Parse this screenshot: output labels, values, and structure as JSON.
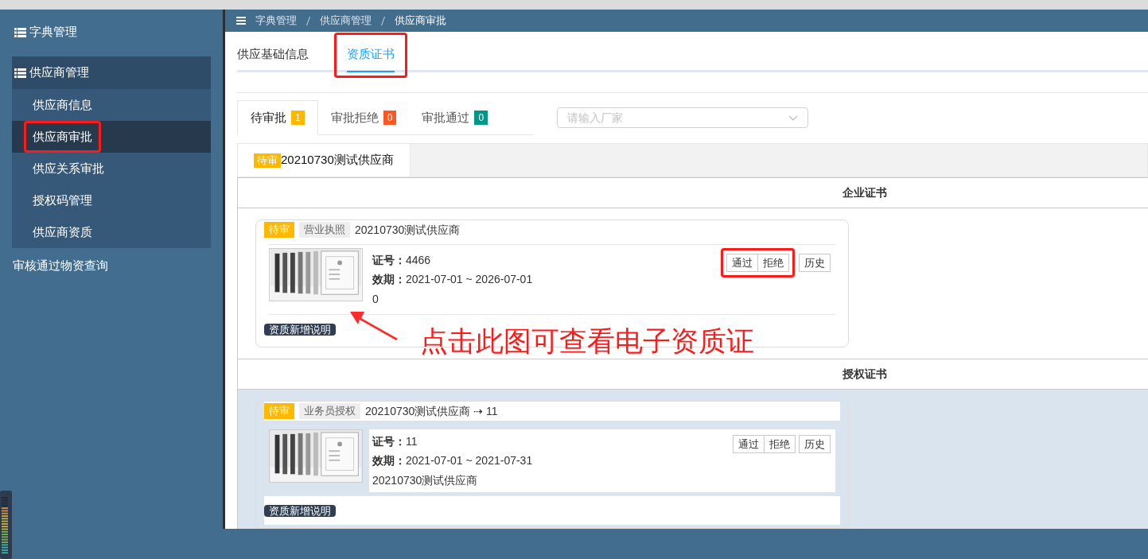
{
  "sidebar": {
    "items": [
      {
        "kind": "group",
        "label": "字典管理",
        "expanded": false
      },
      {
        "kind": "group",
        "label": "供应商管理",
        "expanded": true,
        "children": [
          {
            "label": "供应商信息",
            "selected": false,
            "highlighted": false
          },
          {
            "label": "供应商审批",
            "selected": true,
            "highlighted": true
          },
          {
            "label": "供应关系审批",
            "selected": false,
            "highlighted": false
          },
          {
            "label": "授权码管理",
            "selected": false,
            "highlighted": false
          },
          {
            "label": "供应商资质",
            "selected": false,
            "highlighted": false
          }
        ]
      },
      {
        "kind": "link",
        "label": "审核通过物资查询"
      }
    ]
  },
  "breadcrumb": [
    "字典管理",
    "供应商管理",
    "供应商审批"
  ],
  "tabs": [
    {
      "label": "供应基础信息",
      "selected": false,
      "highlighted": false
    },
    {
      "label": "资质证书",
      "selected": true,
      "highlighted": true
    }
  ],
  "status_tabs": [
    {
      "label": "待审批",
      "count": "1",
      "color": "#ffb800",
      "selected": true
    },
    {
      "label": "审批拒绝",
      "count": "0",
      "color": "#ff5722",
      "selected": false
    },
    {
      "label": "审批通过",
      "count": "0",
      "color": "#009688",
      "selected": false
    }
  ],
  "vendor_filter": {
    "placeholder": "请输入厂家"
  },
  "vendor_tabs": [
    {
      "badge": "待审",
      "label": "20210730测试供应商",
      "selected": true
    }
  ],
  "sections": [
    {
      "title": "企业证书",
      "shaded": false,
      "cards": [
        {
          "status": "待审",
          "type": "营业执照",
          "title": "20210730测试供应商",
          "fields": [
            {
              "label": "证号：",
              "value": "4466"
            },
            {
              "label": "效期：",
              "value": "2021-07-01 ~ 2026-07-01"
            }
          ],
          "note": "0",
          "buttons": [
            "通过",
            "拒绝",
            "历史"
          ],
          "highlight_actions": true,
          "footer": "资质新增说明"
        }
      ]
    },
    {
      "title": "授权证书",
      "shaded": true,
      "cards": [
        {
          "status": "待审",
          "type": "业务员授权",
          "title": "20210730测试供应商 ⇢ 11",
          "fields": [
            {
              "label": "证号：",
              "value": "11"
            },
            {
              "label": "效期：",
              "value": "2021-07-01 ~ 2021-07-31"
            }
          ],
          "note": "20210730测试供应商",
          "buttons": [
            "通过",
            "拒绝",
            "历史"
          ],
          "highlight_actions": false,
          "footer": "资质新增说明"
        }
      ]
    }
  ],
  "annotation": {
    "text": "点击此图可查看电子资质证"
  }
}
